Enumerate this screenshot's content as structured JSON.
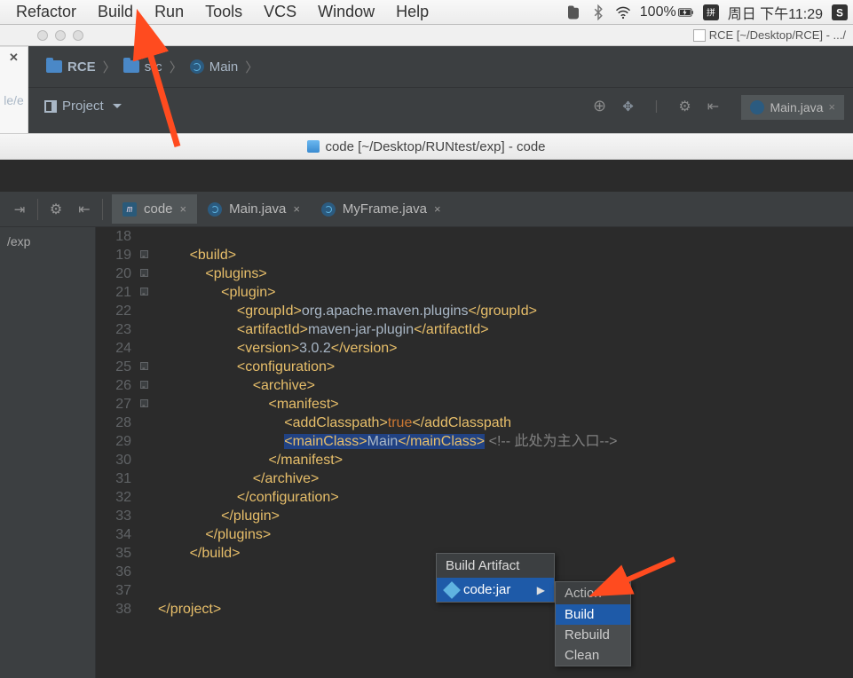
{
  "menubar": {
    "items": [
      "Refactor",
      "Build",
      "Run",
      "Tools",
      "VCS",
      "Window",
      "Help"
    ],
    "battery": "100%",
    "date": "周日 下午11:29"
  },
  "rce_window": {
    "title": "RCE [~/Desktop/RCE] - .../",
    "crumbs": [
      "RCE",
      "src",
      "Main"
    ],
    "project_label": "Project",
    "tab": "Main.java"
  },
  "code_window": {
    "title": "code [~/Desktop/RUNtest/exp] - code",
    "left_panel": "/exp",
    "tabs": [
      {
        "label": "code",
        "icon": "m",
        "active": true
      },
      {
        "label": "Main.java",
        "icon": "j",
        "active": false
      },
      {
        "label": "MyFrame.java",
        "icon": "j",
        "active": false
      }
    ]
  },
  "code_lines": [
    {
      "n": 18,
      "indent": 4,
      "fold": false,
      "html": ""
    },
    {
      "n": 19,
      "indent": 8,
      "fold": true,
      "html": "<span class='tag'>&lt;build&gt;</span>"
    },
    {
      "n": 20,
      "indent": 12,
      "fold": true,
      "html": "<span class='tag'>&lt;plugins&gt;</span>"
    },
    {
      "n": 21,
      "indent": 16,
      "fold": true,
      "html": "<span class='tag'>&lt;plugin&gt;</span>"
    },
    {
      "n": 22,
      "indent": 20,
      "fold": false,
      "html": "<span class='tag'>&lt;groupId&gt;</span><span class='txt'>org.apache.maven.plugins</span><span class='tag'>&lt;/groupId&gt;</span>"
    },
    {
      "n": 23,
      "indent": 20,
      "fold": false,
      "html": "<span class='tag'>&lt;artifactId&gt;</span><span class='txt'>maven-jar-plugin</span><span class='tag'>&lt;/artifactId&gt;</span>"
    },
    {
      "n": 24,
      "indent": 20,
      "fold": false,
      "html": "<span class='tag'>&lt;version&gt;</span><span class='txt'>3.0.2</span><span class='tag'>&lt;/version&gt;</span>"
    },
    {
      "n": 25,
      "indent": 20,
      "fold": true,
      "html": "<span class='tag'>&lt;configuration&gt;</span>"
    },
    {
      "n": 26,
      "indent": 24,
      "fold": true,
      "html": "<span class='tag'>&lt;archive&gt;</span>"
    },
    {
      "n": 27,
      "indent": 28,
      "fold": true,
      "html": "<span class='tag'>&lt;manifest&gt;</span>"
    },
    {
      "n": 28,
      "indent": 32,
      "fold": false,
      "html": "<span class='tag'>&lt;addClasspath&gt;</span><span class='kw'>true</span><span class='tag'>&lt;/addClasspath</span>"
    },
    {
      "n": 29,
      "indent": 32,
      "fold": false,
      "html": "<span class='hl'><span class='tag'>&lt;mainClass&gt;</span><span class='txt'>Main</span><span class='tag'>&lt;/mainClass&gt;</span></span> <span class='cmt'>&lt;!-- 此处为主入口--&gt;</span>"
    },
    {
      "n": 30,
      "indent": 28,
      "fold": false,
      "html": "<span class='tag'>&lt;/manifest&gt;</span>"
    },
    {
      "n": 31,
      "indent": 24,
      "fold": false,
      "html": "<span class='tag'>&lt;/archive&gt;</span>"
    },
    {
      "n": 32,
      "indent": 20,
      "fold": false,
      "html": "<span class='tag'>&lt;/configuration&gt;</span>"
    },
    {
      "n": 33,
      "indent": 16,
      "fold": false,
      "html": "<span class='tag'>&lt;/plugin&gt;</span>"
    },
    {
      "n": 34,
      "indent": 12,
      "fold": false,
      "html": "<span class='tag'>&lt;/plugins&gt;</span>"
    },
    {
      "n": 35,
      "indent": 8,
      "fold": false,
      "html": "<span class='tag'>&lt;/build&gt;</span>"
    },
    {
      "n": 36,
      "indent": 0,
      "fold": false,
      "html": ""
    },
    {
      "n": 37,
      "indent": 0,
      "fold": false,
      "html": ""
    },
    {
      "n": 38,
      "indent": 0,
      "fold": false,
      "html": "<span class='tag'>&lt;/project&gt;</span>"
    }
  ],
  "context_menu1": {
    "header": "Build Artifact",
    "item": "code:jar"
  },
  "context_menu2": {
    "header": "Action",
    "items": [
      "Build",
      "Rebuild",
      "Clean"
    ],
    "selected": 0
  }
}
